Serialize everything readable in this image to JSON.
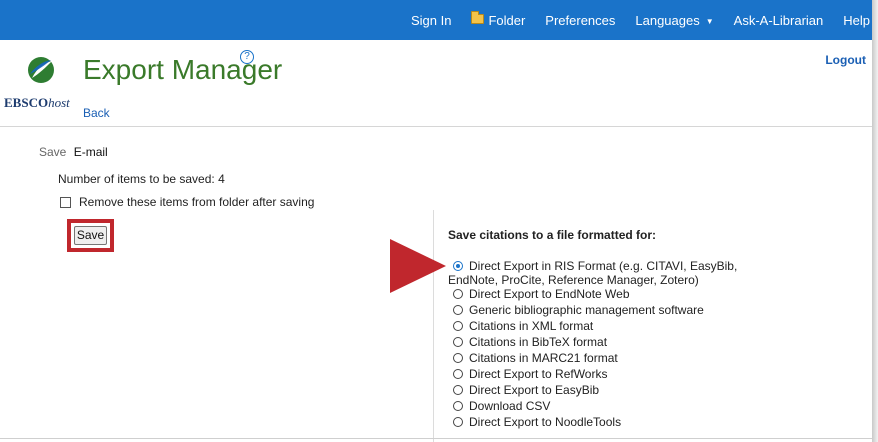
{
  "topnav": {
    "items": [
      {
        "label": "Sign In"
      },
      {
        "label": "Folder",
        "icon": "folder-icon"
      },
      {
        "label": "Preferences"
      },
      {
        "label": "Languages",
        "icon": "caret-down-icon"
      },
      {
        "label": "Ask-A-Librarian"
      },
      {
        "label": "Help"
      }
    ],
    "color": "#1a73c9"
  },
  "header": {
    "logo_brand": "EBSCO",
    "logo_suffix": "host",
    "title": "Export Manager",
    "help_glyph": "?",
    "back_label": "Back",
    "logout_label": "Logout",
    "title_color": "#3a7a2a"
  },
  "save_panel": {
    "save_label": "Save",
    "email_tab": "E-mail",
    "items_count_text": "Number of items to be saved: 4",
    "remove_checkbox_label": "Remove these items from folder after saving",
    "remove_checked": false,
    "save_button": "Save",
    "highlight_color": "#c0272d"
  },
  "formats": {
    "heading": "Save citations to a file formatted for:",
    "selected_index": 0,
    "options": [
      {
        "line1": "Direct Export in RIS Format (e.g. CITAVI, EasyBib,",
        "line2": "EndNote, ProCite, Reference Manager, Zotero)"
      },
      {
        "label": "Direct Export to EndNote Web"
      },
      {
        "label": "Generic bibliographic management software"
      },
      {
        "label": "Citations in XML format"
      },
      {
        "label": "Citations in BibTeX format"
      },
      {
        "label": "Citations in MARC21 format"
      },
      {
        "label": "Direct Export to RefWorks"
      },
      {
        "label": "Direct Export to EasyBib"
      },
      {
        "label": "Download CSV"
      },
      {
        "label": "Direct Export to NoodleTools"
      }
    ],
    "pointer_color": "#c0272d"
  }
}
